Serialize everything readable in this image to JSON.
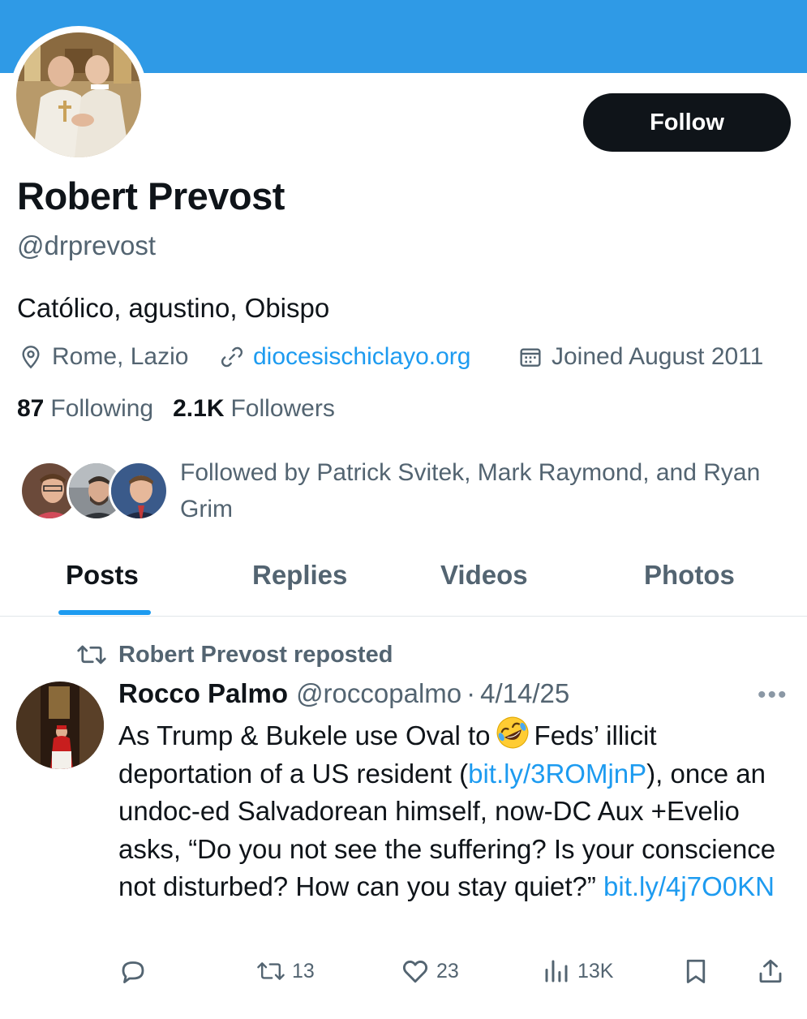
{
  "profile": {
    "display_name": "Robert Prevost",
    "handle": "@drprevost",
    "bio": "Católico, agustino, Obispo",
    "location": "Rome, Lazio",
    "website": "diocesischiclayo.org",
    "joined": "Joined August 2011",
    "following_count": "87",
    "following_label": "Following",
    "followers_count": "2.1K",
    "followers_label": "Followers",
    "followed_by": "Followed by Patrick Svitek, Mark Raymond, and Ryan Grim",
    "follow_button": "Follow"
  },
  "tabs": [
    {
      "label": "Posts",
      "active": true
    },
    {
      "label": "Replies",
      "active": false
    },
    {
      "label": "Videos",
      "active": false
    },
    {
      "label": "Photos",
      "active": false
    }
  ],
  "tweet": {
    "repost_label": "Robert Prevost reposted",
    "author_name": "Rocco Palmo",
    "author_handle": "@roccopalmo",
    "separator": "·",
    "date": "4/14/25",
    "more": "•••",
    "text_part1": "As Trump & Bukele use Oval to",
    "text_part2": "Feds’ illicit deportation of a US resident (",
    "link1": "bit.ly/3ROMjnP",
    "text_part3": "), once an undoc-ed Salvadorean himself, now-DC Aux +Evelio asks, “Do you not see the suffering? Is your conscience not disturbed? How can you stay quiet?”",
    "link2": "bit.ly/4j7O0KN",
    "emoji": "rolling-on-floor-laughing-emoji",
    "reply_count": "",
    "retweet_count": "13",
    "like_count": "23",
    "view_count": "13K"
  },
  "colors": {
    "banner": "#2f9ae6",
    "accent": "#1d9bf0",
    "text": "#0f1419",
    "muted": "#536471",
    "button": "#0f1419"
  },
  "icons": [
    "location-pin-icon",
    "link-icon",
    "calendar-icon",
    "retweet-icon",
    "more-icon",
    "reply-icon",
    "like-icon",
    "views-icon",
    "bookmark-icon",
    "share-icon"
  ]
}
